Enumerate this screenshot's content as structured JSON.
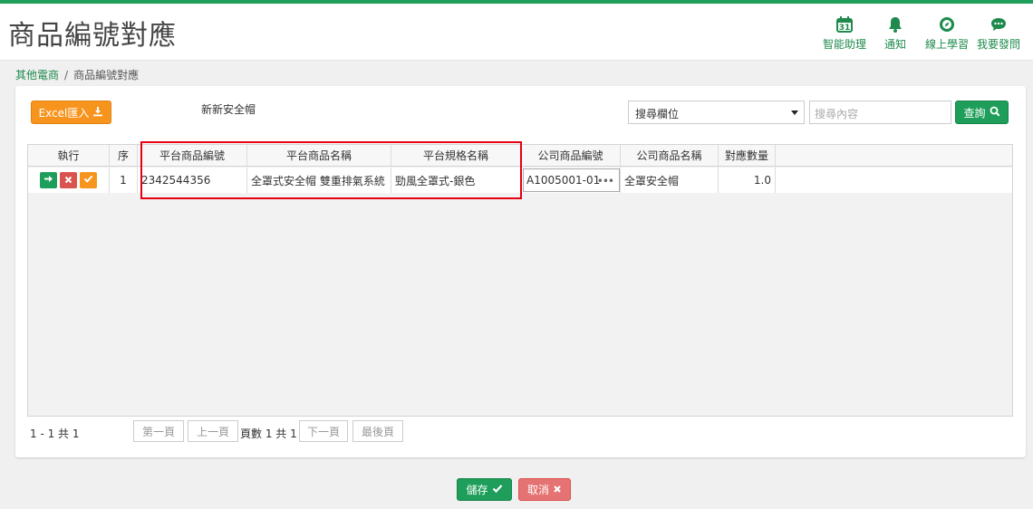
{
  "header": {
    "title": "商品編號對應",
    "actions": [
      {
        "label": "智能助理",
        "icon": "calendar-icon",
        "badge": "31"
      },
      {
        "label": "通知",
        "icon": "bell-icon"
      },
      {
        "label": "線上學習",
        "icon": "compass-icon"
      },
      {
        "label": "我要發問",
        "icon": "chat-bubble-icon"
      }
    ]
  },
  "breadcrumb": {
    "parent": "其他電商",
    "separator": "/",
    "current": "商品編號對應"
  },
  "toolbar": {
    "excel_label": "Excel匯入",
    "store_name": "新新安全帽",
    "search_field_label": "搜尋欄位",
    "search_placeholder": "搜尋內容",
    "query_label": "查詢"
  },
  "grid": {
    "columns": [
      "執行",
      "序",
      "平台商品編號",
      "平台商品名稱",
      "平台規格名稱",
      "公司商品編號",
      "公司商品名稱",
      "對應數量"
    ],
    "rows": [
      {
        "seq": "1",
        "platform_code": "2342544356",
        "platform_name": "全罩式安全帽 雙重排氣系統",
        "platform_spec": "勁風全罩式-銀色",
        "company_code": "A1005001-01",
        "company_name": "全罩安全帽",
        "qty": "1.0"
      }
    ]
  },
  "pager": {
    "range": "1 - 1 共 1",
    "first": "第一頁",
    "prev": "上一頁",
    "info": "頁數 1 共 1",
    "next": "下一頁",
    "last": "最後頁"
  },
  "footer": {
    "save_label": "儲存",
    "cancel_label": "取消"
  },
  "colors": {
    "brand_green": "#1e9e5a",
    "orange": "#f7941d",
    "red": "#d9534f",
    "highlight": "#e60012"
  }
}
